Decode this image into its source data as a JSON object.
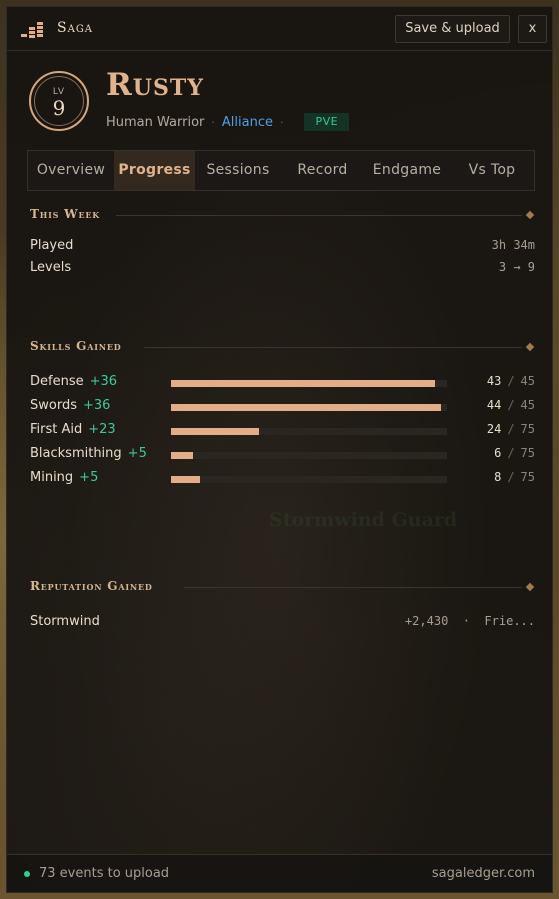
{
  "app": {
    "name": "Saga",
    "upload_button": "Save & upload",
    "close_button": "x",
    "logo_icon": "bar-stack-logo-icon",
    "accent_color": "#e1b38c"
  },
  "character": {
    "level_label": "LV",
    "level": "9",
    "name": "Rusty",
    "race_class": "Human Warrior",
    "separator": "·",
    "faction": "Alliance",
    "mode": "PVE"
  },
  "tabs": [
    {
      "label": "Overview",
      "active": false
    },
    {
      "label": "Progress",
      "active": true
    },
    {
      "label": "Sessions",
      "active": false
    },
    {
      "label": "Record",
      "active": false
    },
    {
      "label": "Endgame",
      "active": false
    },
    {
      "label": "Vs Top",
      "active": false
    }
  ],
  "this_week": {
    "title": "This Week",
    "rows": [
      {
        "label": "Played",
        "value": "3h 34m"
      },
      {
        "label": "Levels",
        "value": "3 → 9"
      }
    ]
  },
  "skills": {
    "title": "Skills Gained",
    "items": [
      {
        "name": "Defense",
        "gain": "+36",
        "current": 43,
        "max": 45
      },
      {
        "name": "Swords",
        "gain": "+36",
        "current": 44,
        "max": 45
      },
      {
        "name": "First Aid",
        "gain": "+23",
        "current": 24,
        "max": 75
      },
      {
        "name": "Blacksmithing",
        "gain": "+5",
        "current": 6,
        "max": 75
      },
      {
        "name": "Mining",
        "gain": "+5",
        "current": 8,
        "max": 75
      }
    ],
    "separator": "/"
  },
  "reputation": {
    "title": "Reputation Gained",
    "rows": [
      {
        "name": "Stormwind",
        "value": "+2,430  ·  Frie..."
      }
    ]
  },
  "background": {
    "label": "Stormwind Guard"
  },
  "footer": {
    "status": "73 events to upload",
    "site": "sagaledger.com"
  }
}
